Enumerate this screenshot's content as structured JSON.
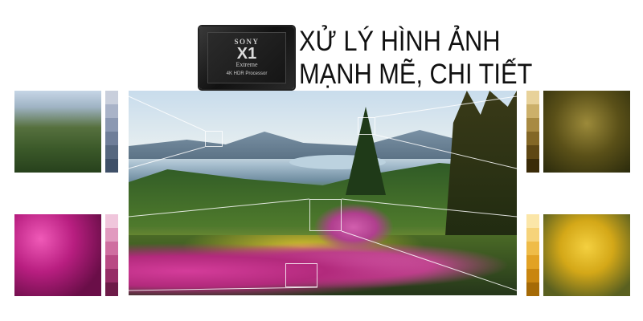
{
  "chip": {
    "brand": "SONY",
    "model": "X1",
    "variant": "Extreme",
    "subtitle": "4K HDR Processor"
  },
  "headline": {
    "line1": "XỬ LÝ HÌNH ẢNH",
    "line2": "MẠNH MẼ, CHI TIẾT"
  },
  "swatches": {
    "top_left": [
      "#c9cfdc",
      "#a9b3c8",
      "#8b98b2",
      "#6f7e99",
      "#56677f",
      "#3f5068"
    ],
    "bottom_left": [
      "#f0c6dc",
      "#e19abf",
      "#cf6ea0",
      "#b94a84",
      "#962d66",
      "#6d1b48"
    ],
    "top_right": [
      "#e8d29a",
      "#ccb06a",
      "#a88a42",
      "#836726",
      "#5e4714",
      "#3a2b08"
    ],
    "bottom_right": [
      "#fbe6a8",
      "#f6d37a",
      "#efbc48",
      "#e2a224",
      "#c98610",
      "#a56a06"
    ]
  }
}
